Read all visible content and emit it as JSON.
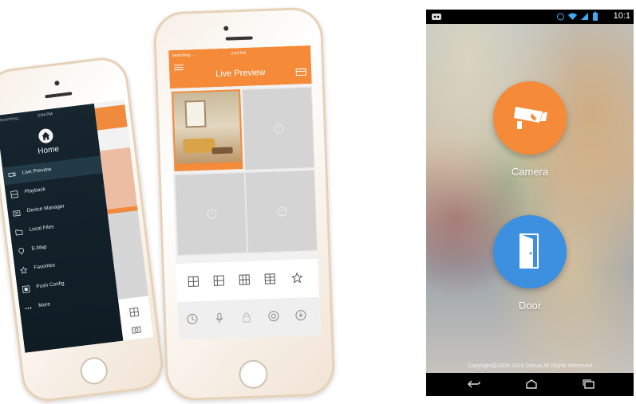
{
  "phone_menu": {
    "status": "Searching...",
    "time": "2:04 PM",
    "home_label": "Home",
    "items": [
      {
        "label": "Live Preview",
        "icon": "live-preview-icon",
        "active": true
      },
      {
        "label": "Playback",
        "icon": "playback-icon"
      },
      {
        "label": "Device Manager",
        "icon": "device-manager-icon"
      },
      {
        "label": "Local Files",
        "icon": "folder-icon"
      },
      {
        "label": "E-Map",
        "icon": "map-pin-icon"
      },
      {
        "label": "Favorites",
        "icon": "star-icon"
      },
      {
        "label": "Push Config",
        "icon": "push-config-icon"
      },
      {
        "label": "More",
        "icon": "more-icon"
      }
    ]
  },
  "phone_live": {
    "status": "Searching...",
    "time": "2:04 PM",
    "title": "Live Preview",
    "accent": "#f58a38"
  },
  "android_app": {
    "clock": "10:1",
    "camera_label": "Camera",
    "door_label": "Door",
    "copyright": "Copyright@2009-2015 Dahua All Rights Reserved",
    "camera_color": "#f58a38",
    "door_color": "#3d8fe0"
  }
}
